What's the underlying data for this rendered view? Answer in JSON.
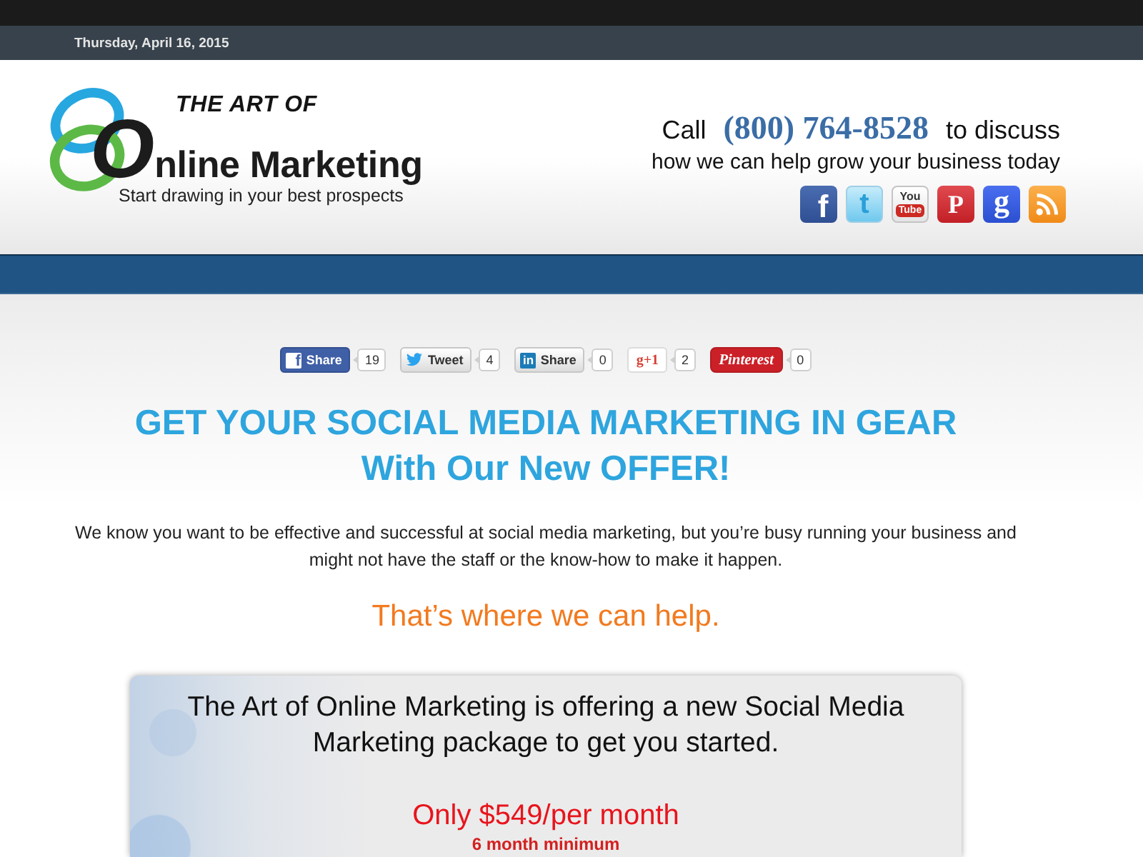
{
  "top_bar": {
    "date": "Thursday, April 16, 2015"
  },
  "header": {
    "logo": {
      "overline": "THE ART OF",
      "name": "Online Marketing",
      "tagline": "Start drawing in your best prospects"
    },
    "contact": {
      "prefix": "Call",
      "phone": "(800) 764-8528",
      "suffix": "to discuss",
      "subline": "how we can help grow your business today"
    },
    "social_icons": [
      {
        "kind": "facebook",
        "glyph": "f"
      },
      {
        "kind": "twitter",
        "glyph": "t"
      },
      {
        "kind": "youtube",
        "glyph_lines": [
          "You",
          "Tube"
        ]
      },
      {
        "kind": "pinterest",
        "glyph": "P"
      },
      {
        "kind": "google",
        "glyph": "g"
      },
      {
        "kind": "rss"
      }
    ]
  },
  "share_bar": [
    {
      "kind": "facebook",
      "icon_glyph": "f",
      "label": "Share",
      "count": "19"
    },
    {
      "kind": "twitter",
      "label": "Tweet",
      "count": "4"
    },
    {
      "kind": "linkedin",
      "icon_glyph": "in",
      "label": "Share",
      "count": "0"
    },
    {
      "kind": "googleplus",
      "label": "g+1",
      "count": "2"
    },
    {
      "kind": "pinterest",
      "label": "Pinterest",
      "count": "0"
    }
  ],
  "headline": [
    "GET YOUR SOCIAL MEDIA MARKETING IN GEAR",
    "With Our New OFFER!"
  ],
  "intro": "We know you want to be effective and successful at social media marketing, but you’re busy running your business and might not have the staff or the know-how to make it happen.",
  "callout": "That’s where we can help.",
  "offer": {
    "description": "The Art of Online Marketing is offering a new Social Media Marketing package to get you started.",
    "price": "Only $549/per month",
    "term": "6 month minimum"
  }
}
